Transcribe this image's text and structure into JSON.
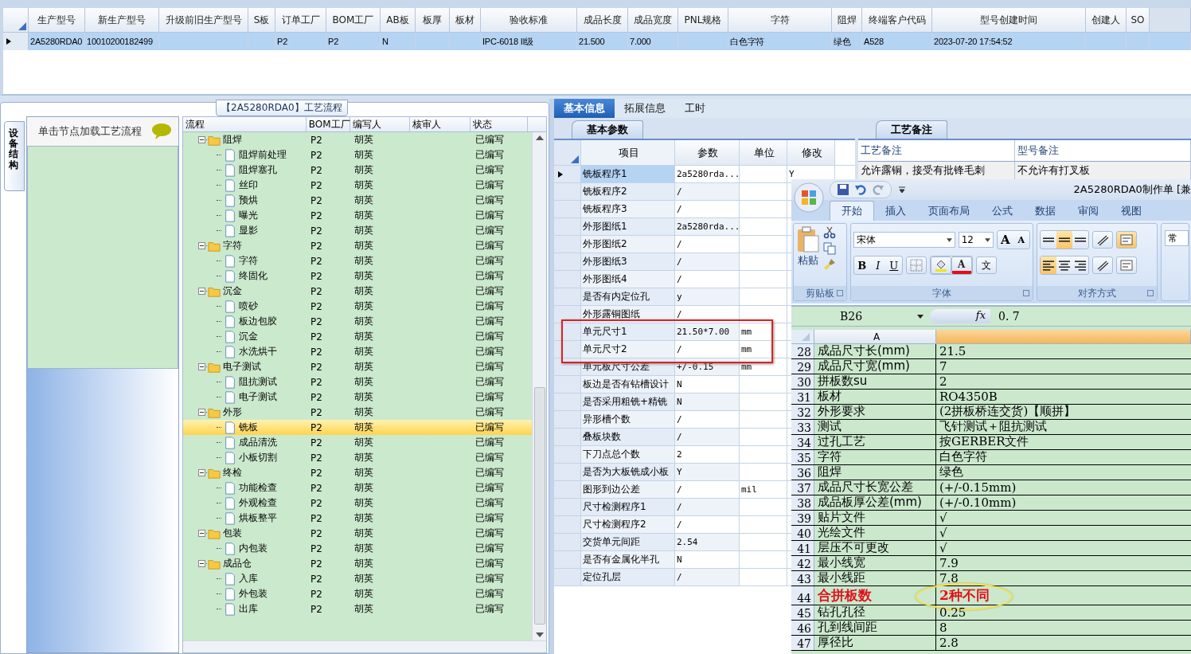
{
  "top_grid": {
    "row_selected": true,
    "columns": [
      {
        "label": "生产型号",
        "value": "2A5280RDA0"
      },
      {
        "label": "新生产型号",
        "value": "10010200182499"
      },
      {
        "label": "升级前旧生产型号"
      },
      {
        "label": "S板"
      },
      {
        "label": "订单工厂",
        "value": "P2"
      },
      {
        "label": "BOM工厂",
        "value": "P2"
      },
      {
        "label": "AB板",
        "value": "N"
      },
      {
        "label": "板厚"
      },
      {
        "label": "板材"
      },
      {
        "label": "验收标准",
        "value": "IPC-6018 II级"
      },
      {
        "label": "成品长度",
        "value": "21.500"
      },
      {
        "label": "成品宽度",
        "value": "7.000"
      },
      {
        "label": "PNL规格"
      },
      {
        "label": "字符",
        "value": "白色字符"
      },
      {
        "label": "阻焊",
        "value": "绿色"
      },
      {
        "label": "终端客户代码",
        "value": "A528"
      },
      {
        "label": "型号创建时间",
        "value": "2023-07-20 17:54:52"
      },
      {
        "label": "创建人"
      },
      {
        "label": "SO"
      }
    ]
  },
  "process": {
    "title": "【2A5280RDA0】工艺流程",
    "side_tab": "设备结构",
    "hint": "单击节点加载工艺流程",
    "columns": [
      "流程",
      "BOM工厂",
      "编写人",
      "核审人",
      "状态"
    ],
    "tree": [
      {
        "name": "阻焊",
        "bom": "P2",
        "writer": "胡英",
        "status": "已编写",
        "expanded": true,
        "selected": false,
        "children": [
          {
            "name": "阻焊前处理",
            "bom": "P2",
            "writer": "胡英",
            "status": "已编写",
            "selected": false
          },
          {
            "name": "阻焊塞孔",
            "bom": "P2",
            "writer": "胡英",
            "status": "已编写",
            "selected": false
          },
          {
            "name": "丝印",
            "bom": "P2",
            "writer": "胡英",
            "status": "已编写",
            "selected": false
          },
          {
            "name": "预烘",
            "bom": "P2",
            "writer": "胡英",
            "status": "已编写",
            "selected": false
          },
          {
            "name": "曝光",
            "bom": "P2",
            "writer": "胡英",
            "status": "已编写",
            "selected": false
          },
          {
            "name": "显影",
            "bom": "P2",
            "writer": "胡英",
            "status": "已编写",
            "selected": false
          }
        ]
      },
      {
        "name": "字符",
        "bom": "P2",
        "writer": "胡英",
        "status": "已编写",
        "expanded": true,
        "selected": false,
        "children": [
          {
            "name": "字符",
            "bom": "P2",
            "writer": "胡英",
            "status": "已编写",
            "selected": false
          },
          {
            "name": "终固化",
            "bom": "P2",
            "writer": "胡英",
            "status": "已编写",
            "selected": false
          }
        ]
      },
      {
        "name": "沉金",
        "bom": "P2",
        "writer": "胡英",
        "status": "已编写",
        "expanded": true,
        "selected": false,
        "children": [
          {
            "name": "喷砂",
            "bom": "P2",
            "writer": "胡英",
            "status": "已编写",
            "selected": false
          },
          {
            "name": "板边包胶",
            "bom": "P2",
            "writer": "胡英",
            "status": "已编写",
            "selected": false
          },
          {
            "name": "沉金",
            "bom": "P2",
            "writer": "胡英",
            "status": "已编写",
            "selected": false
          },
          {
            "name": "水洗烘干",
            "bom": "P2",
            "writer": "胡英",
            "status": "已编写",
            "selected": false
          }
        ]
      },
      {
        "name": "电子测试",
        "bom": "P2",
        "writer": "胡英",
        "status": "已编写",
        "expanded": true,
        "selected": false,
        "children": [
          {
            "name": "阻抗测试",
            "bom": "P2",
            "writer": "胡英",
            "status": "已编写",
            "selected": false
          },
          {
            "name": "电子测试",
            "bom": "P2",
            "writer": "胡英",
            "status": "已编写",
            "selected": false
          }
        ]
      },
      {
        "name": "外形",
        "bom": "P2",
        "writer": "胡英",
        "status": "已编写",
        "expanded": true,
        "selected": false,
        "children": [
          {
            "name": "铣板",
            "bom": "P2",
            "writer": "胡英",
            "status": "已编写",
            "selected": true
          },
          {
            "name": "成品清洗",
            "bom": "P2",
            "writer": "胡英",
            "status": "已编写",
            "selected": false
          },
          {
            "name": "小板切割",
            "bom": "P2",
            "writer": "胡英",
            "status": "已编写",
            "selected": false
          }
        ]
      },
      {
        "name": "终检",
        "bom": "P2",
        "writer": "胡英",
        "status": "已编写",
        "expanded": true,
        "selected": false,
        "children": [
          {
            "name": "功能检查",
            "bom": "P2",
            "writer": "胡英",
            "status": "已编写",
            "selected": false
          },
          {
            "name": "外观检查",
            "bom": "P2",
            "writer": "胡英",
            "status": "已编写",
            "selected": false
          },
          {
            "name": "烘板整平",
            "bom": "P2",
            "writer": "胡英",
            "status": "已编写",
            "selected": false
          }
        ]
      },
      {
        "name": "包装",
        "bom": "P2",
        "writer": "胡英",
        "status": "已编写",
        "expanded": true,
        "selected": false,
        "children": [
          {
            "name": "内包装",
            "bom": "P2",
            "writer": "胡英",
            "status": "已编写",
            "selected": false
          }
        ]
      },
      {
        "name": "成品仓",
        "bom": "P2",
        "writer": "胡英",
        "status": "已编写",
        "expanded": true,
        "selected": false,
        "children": [
          {
            "name": "入库",
            "bom": "P2",
            "writer": "胡英",
            "status": "已编写",
            "selected": false
          },
          {
            "name": "外包装",
            "bom": "P2",
            "writer": "胡英",
            "status": "已编写",
            "selected": false
          },
          {
            "name": "出库",
            "bom": "P2",
            "writer": "胡英",
            "status": "已编写",
            "selected": false
          }
        ]
      }
    ]
  },
  "info_tabs": [
    {
      "label": "基本信息",
      "selected": true
    },
    {
      "label": "拓展信息",
      "selected": false
    },
    {
      "label": "工时",
      "selected": false
    }
  ],
  "params": {
    "tab": "基本参数",
    "columns": [
      "项目",
      "参数",
      "单位",
      "修改"
    ],
    "rows": [
      {
        "item": "铣板程序1",
        "value": "2a5280rda...",
        "modified": "Y",
        "selected": true,
        "marked": false
      },
      {
        "item": "铣板程序2",
        "value": "/",
        "selected": false,
        "marked": false
      },
      {
        "item": "铣板程序3",
        "value": "/",
        "selected": false,
        "marked": false
      },
      {
        "item": "外形图纸1",
        "value": "2a5280rda...",
        "selected": false,
        "marked": false
      },
      {
        "item": "外形图纸2",
        "value": "/",
        "selected": false,
        "marked": false
      },
      {
        "item": "外形图纸3",
        "value": "/",
        "selected": false,
        "marked": false
      },
      {
        "item": "外形图纸4",
        "value": "/",
        "selected": false,
        "marked": false
      },
      {
        "item": "是否有内定位孔",
        "value": "y",
        "selected": false,
        "marked": false
      },
      {
        "item": "外形露铜图纸",
        "value": "/",
        "selected": false,
        "marked": false
      },
      {
        "item": "单元尺寸1",
        "value": "21.50*7.00",
        "unit": "mm",
        "selected": false,
        "marked": true
      },
      {
        "item": "单元尺寸2",
        "value": "/",
        "unit": "mm",
        "selected": false,
        "marked": true
      },
      {
        "item": "单元板尺寸公差",
        "value": "+/-0.15",
        "unit": "mm",
        "selected": false,
        "marked": false
      },
      {
        "item": "板边是否有钻槽设计",
        "value": "N",
        "selected": false,
        "marked": false
      },
      {
        "item": "是否采用粗铣+精铣",
        "value": "N",
        "selected": false,
        "marked": false
      },
      {
        "item": "异形槽个数",
        "value": "/",
        "selected": false,
        "marked": false
      },
      {
        "item": "叠板块数",
        "value": "/",
        "selected": false,
        "marked": false
      },
      {
        "item": "下刀点总个数",
        "value": "2",
        "selected": false,
        "marked": false
      },
      {
        "item": "是否为大板铣成小板",
        "value": "Y",
        "selected": false,
        "marked": false
      },
      {
        "item": "图形到边公差",
        "value": "/",
        "unit": "mil",
        "selected": false,
        "marked": false
      },
      {
        "item": "尺寸检测程序1",
        "value": "/",
        "selected": false,
        "marked": false
      },
      {
        "item": "尺寸检测程序2",
        "value": "/",
        "selected": false,
        "marked": false
      },
      {
        "item": "交货单元间距",
        "value": "2.54",
        "selected": false,
        "marked": false
      },
      {
        "item": "是否有金属化半孔",
        "value": "N",
        "selected": false,
        "marked": false
      },
      {
        "item": "定位孔层",
        "value": "/",
        "selected": false,
        "marked": false
      }
    ]
  },
  "remarks": {
    "tab": "工艺备注",
    "columns": [
      "工艺备注",
      "型号备注"
    ],
    "values": [
      "允许露铜，接受有批锋毛刺",
      "不允许有打叉板"
    ]
  },
  "excel": {
    "title": "2A5280RDA0制作单 [兼",
    "tabs": [
      {
        "label": "开始",
        "selected": true
      },
      {
        "label": "插入",
        "selected": false
      },
      {
        "label": "页面布局",
        "selected": false
      },
      {
        "label": "公式",
        "selected": false
      },
      {
        "label": "数据",
        "selected": false
      },
      {
        "label": "审阅",
        "selected": false
      },
      {
        "label": "视图",
        "selected": false
      }
    ],
    "paste": "粘贴",
    "font": "宋体",
    "size": "12",
    "grow": "A",
    "shrink": "A",
    "format_buttons": [
      "B",
      "I",
      "U"
    ],
    "font_color": "A",
    "phonetic": "文",
    "align_buttons": [
      {
        "kind": "top",
        "selected": false
      },
      {
        "kind": "middle",
        "selected": true
      },
      {
        "kind": "bottom",
        "selected": false
      },
      {
        "kind": "left",
        "selected": true
      },
      {
        "kind": "center",
        "selected": false
      },
      {
        "kind": "right",
        "selected": false
      }
    ],
    "groups": [
      "剪贴板",
      "字体",
      "对齐方式"
    ],
    "next_group": "常",
    "cell_ref": "B26",
    "fx": "fx",
    "formula": "0. 7",
    "column_a": "A",
    "rows": [
      {
        "num": "28",
        "a": "成品尺寸长(mm)",
        "b": "21.5",
        "emphasis": false
      },
      {
        "num": "29",
        "a": "成品尺寸宽(mm)",
        "b": "7",
        "emphasis": false
      },
      {
        "num": "30",
        "a": "拼板数su",
        "b": "2",
        "emphasis": false
      },
      {
        "num": "31",
        "a": "板材",
        "b": "RO4350B",
        "emphasis": false
      },
      {
        "num": "32",
        "a": "外形要求",
        "b": "(2拼板桥连交货)【顺拼】",
        "emphasis": false
      },
      {
        "num": "33",
        "a": "测试",
        "b": "飞针测试＋阻抗测试",
        "emphasis": false
      },
      {
        "num": "34",
        "a": "过孔工艺",
        "b": "按GERBER文件",
        "emphasis": false
      },
      {
        "num": "35",
        "a": "字符",
        "b": "白色字符",
        "emphasis": false
      },
      {
        "num": "36",
        "a": "阻焊",
        "b": "绿色",
        "emphasis": false
      },
      {
        "num": "37",
        "a": "成品尺寸长宽公差",
        "b": "(+/-0.15mm)",
        "emphasis": false
      },
      {
        "num": "38",
        "a": "成品板厚公差(mm)",
        "b": "(+/-0.10mm)",
        "emphasis": false
      },
      {
        "num": "39",
        "a": "贴片文件",
        "b": "√",
        "emphasis": false
      },
      {
        "num": "40",
        "a": "光绘文件",
        "b": "√",
        "emphasis": false
      },
      {
        "num": "41",
        "a": "层压不可更改",
        "b": "√",
        "emphasis": false
      },
      {
        "num": "42",
        "a": "最小线宽",
        "b": "7.9",
        "emphasis": false
      },
      {
        "num": "43",
        "a": "最小线距",
        "b": "7.8",
        "emphasis": false
      },
      {
        "num": "44",
        "a": "合拼板数",
        "b": "2种不同",
        "emphasis": true
      },
      {
        "num": "45",
        "a": "钻孔孔径",
        "b": "0.25",
        "emphasis": false
      },
      {
        "num": "46",
        "a": "孔到线间距",
        "b": "8",
        "emphasis": false
      },
      {
        "num": "47",
        "a": "厚径比",
        "b": "2.8",
        "emphasis": false
      }
    ]
  }
}
